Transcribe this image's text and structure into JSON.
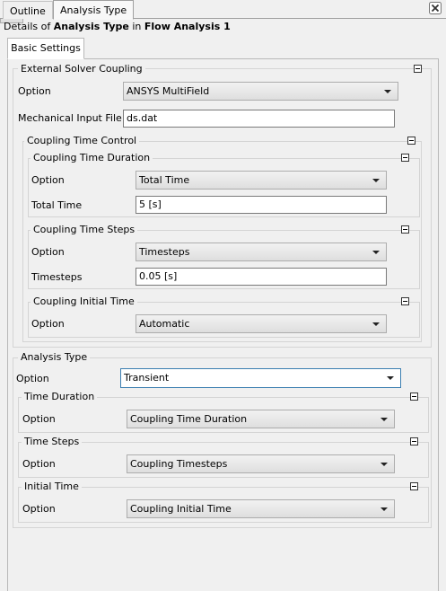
{
  "top_tabs": [
    {
      "label": "Outline"
    },
    {
      "label": "Analysis Type"
    }
  ],
  "details": {
    "prefix": "Details of ",
    "object": "Analysis Type",
    "mid": " in ",
    "target": "Flow Analysis 1"
  },
  "inner_tab": {
    "label": "Basic Settings"
  },
  "external_solver": {
    "title": "External Solver Coupling",
    "option_label": "Option",
    "option_value": "ANSYS MultiField",
    "mech_label": "Mechanical Input File",
    "mech_value": "ds.dat",
    "coupling_time_control": {
      "title": "Coupling Time Control",
      "duration": {
        "title": "Coupling Time Duration",
        "option_label": "Option",
        "option_value": "Total Time",
        "total_label": "Total Time",
        "total_value": "5 [s]"
      },
      "steps": {
        "title": "Coupling Time Steps",
        "option_label": "Option",
        "option_value": "Timesteps",
        "timesteps_label": "Timesteps",
        "timesteps_value": "0.05 [s]"
      },
      "initial": {
        "title": "Coupling Initial Time",
        "option_label": "Option",
        "option_value": "Automatic"
      }
    }
  },
  "analysis_type": {
    "title": "Analysis Type",
    "option_label": "Option",
    "option_value": "Transient",
    "time_duration": {
      "title": "Time Duration",
      "option_label": "Option",
      "option_value": "Coupling Time Duration"
    },
    "time_steps": {
      "title": "Time Steps",
      "option_label": "Option",
      "option_value": "Coupling Timesteps"
    },
    "initial_time": {
      "title": "Initial Time",
      "option_label": "Option",
      "option_value": "Coupling Initial Time"
    }
  },
  "icons": {
    "close": "close-icon",
    "collapse": "collapse-minus-icon",
    "dropdown": "chevron-down-icon",
    "browse": "folder-open-icon"
  },
  "colors": {
    "background": "#f0f0f0",
    "active_border": "#3c7fb1",
    "close_red": "#c8372d",
    "folder_yellow": "#f5c542"
  }
}
